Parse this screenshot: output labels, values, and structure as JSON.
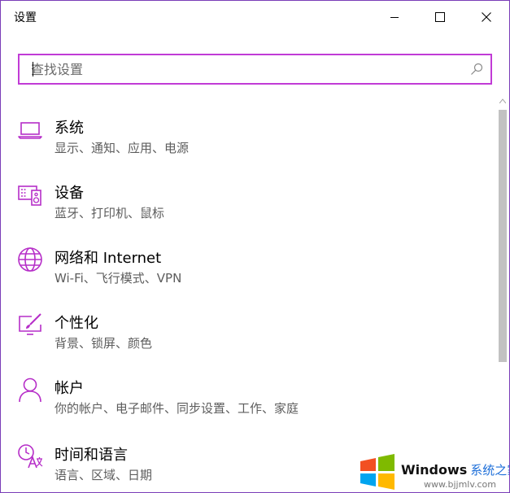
{
  "window": {
    "title": "设置",
    "minimize_icon": "minimize-icon",
    "maximize_icon": "maximize-icon",
    "close_icon": "close-icon"
  },
  "search": {
    "placeholder": "查找设置",
    "value": "",
    "icon": "search-icon"
  },
  "categories": [
    {
      "name": "系统",
      "desc": "显示、通知、应用、电源",
      "icon": "laptop-icon"
    },
    {
      "name": "设备",
      "desc": "蓝牙、打印机、鼠标",
      "icon": "devices-icon"
    },
    {
      "name": "网络和 Internet",
      "desc": "Wi-Fi、飞行模式、VPN",
      "icon": "globe-icon"
    },
    {
      "name": "个性化",
      "desc": "背景、锁屏、颜色",
      "icon": "personalization-icon"
    },
    {
      "name": "帐户",
      "desc": "你的帐户、电子邮件、同步设置、工作、家庭",
      "icon": "person-icon"
    },
    {
      "name": "时间和语言",
      "desc": "语言、区域、日期",
      "icon": "time-language-icon"
    }
  ],
  "watermark": {
    "title": "Windows",
    "title_cn": "系统之家",
    "url": "www.bjjmlv.com"
  },
  "colors": {
    "accent": "#c13bd6",
    "window_border": "#7a3db8",
    "secondary_text": "#5d5d5d"
  }
}
